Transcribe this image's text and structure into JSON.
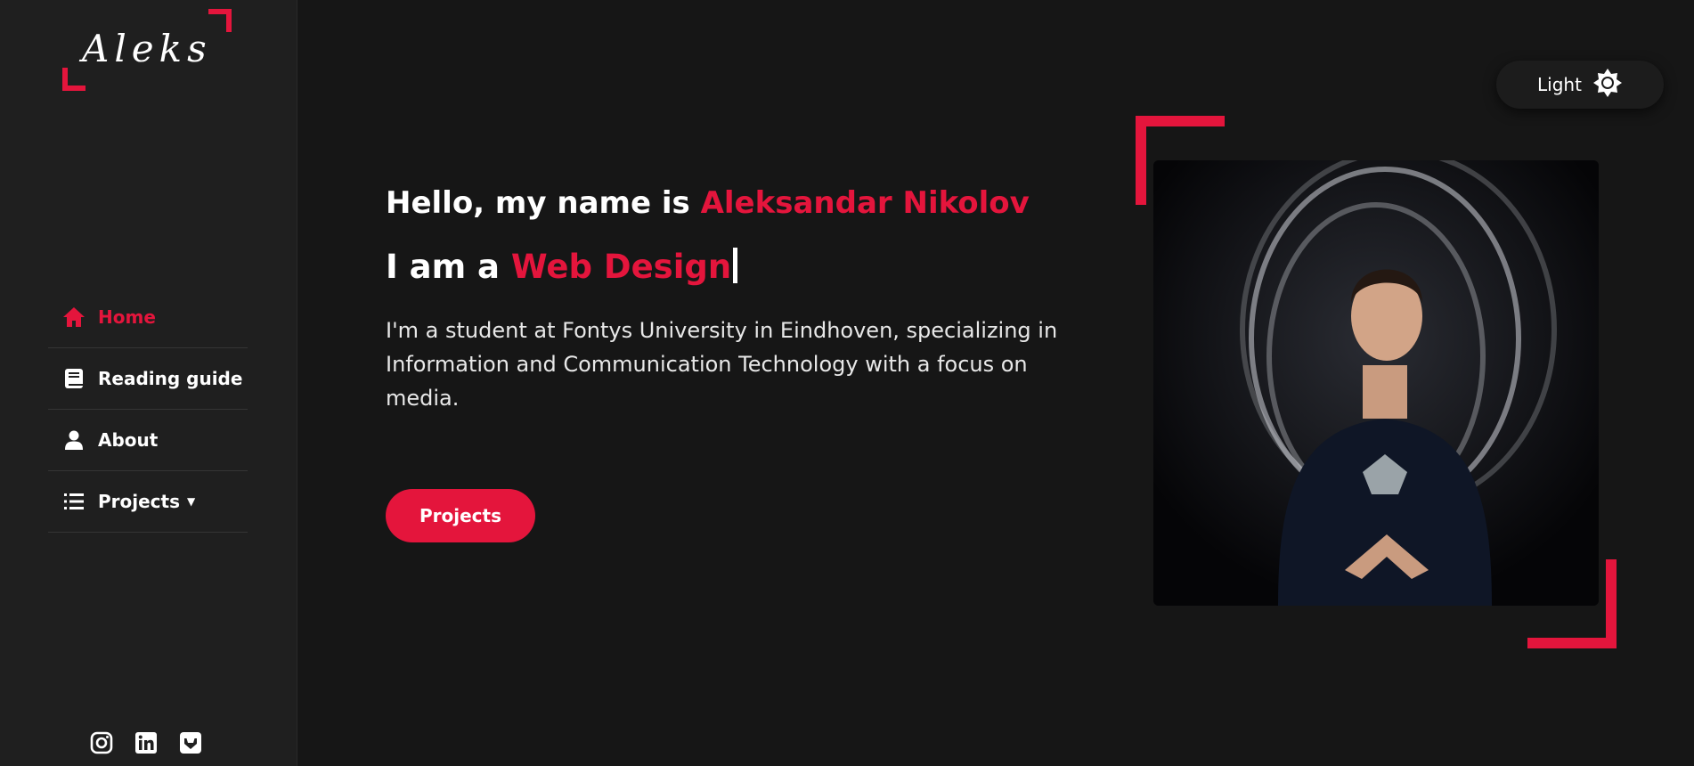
{
  "sidebar": {
    "logo": "Aleks",
    "nav": [
      {
        "label": "Home",
        "icon": "home-icon",
        "active": true
      },
      {
        "label": "Reading guide",
        "icon": "book-icon",
        "active": false
      },
      {
        "label": "About",
        "icon": "user-icon",
        "active": false
      },
      {
        "label": "Projects",
        "icon": "list-icon",
        "active": false,
        "has_dropdown": true
      }
    ],
    "socials": [
      "instagram-icon",
      "linkedin-icon",
      "gitlab-icon"
    ]
  },
  "theme_toggle": {
    "label": "Light",
    "icon": "sun-icon"
  },
  "hero": {
    "greeting_prefix": "Hello, my name is ",
    "name": "Aleksandar Nikolov",
    "role_prefix": "I am a ",
    "role": "Web Design",
    "intro": "I'm a student at Fontys University in Eindhoven, specializing in Information and Communication Technology with a focus on media.",
    "cta_label": "Projects"
  },
  "colors": {
    "accent": "#e4153c",
    "background": "#161616",
    "sidebar": "#1f1f1f"
  }
}
